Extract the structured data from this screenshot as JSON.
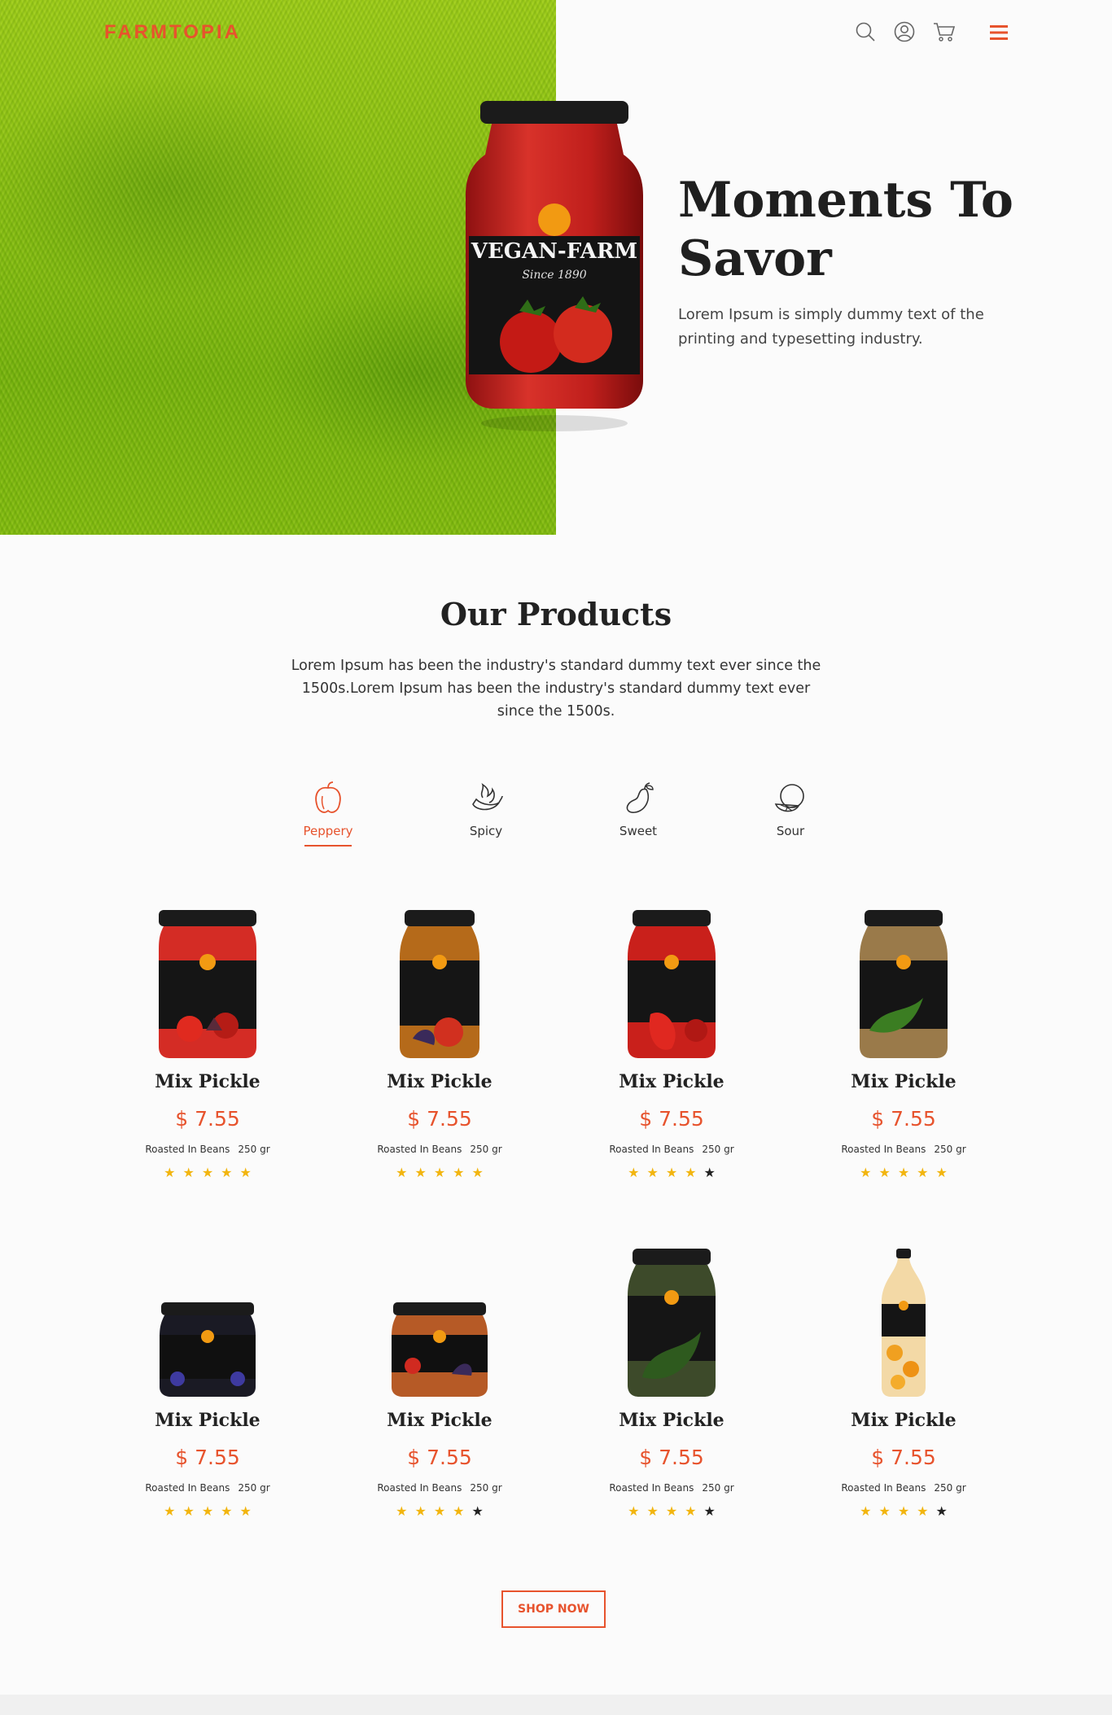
{
  "brand": {
    "logo": "FARMTOPIA",
    "accent": "#e7532d"
  },
  "header": {
    "icons": [
      "search-icon",
      "user-icon",
      "cart-icon",
      "menu-icon"
    ]
  },
  "hero": {
    "title": "Moments To Savor",
    "text": "Lorem Ipsum is simply dummy text of the printing and typesetting industry.",
    "jar_label": "VEGAN-FARM",
    "jar_sub": "Since 1890"
  },
  "products_section": {
    "title": "Our Products",
    "text": "Lorem Ipsum has been the industry's standard dummy text ever since the 1500s.Lorem Ipsum has been the industry's standard dummy text ever since the 1500s."
  },
  "categories": [
    {
      "label": "Peppery",
      "icon": "bell-pepper-icon",
      "active": true
    },
    {
      "label": "Spicy",
      "icon": "chili-flame-icon",
      "active": false
    },
    {
      "label": "Sweet",
      "icon": "mango-icon",
      "active": false
    },
    {
      "label": "Sour",
      "icon": "citrus-icon",
      "active": false
    }
  ],
  "products": [
    {
      "name": "Mix Pickle",
      "price": "$ 7.55",
      "tag": "Roasted In Beans",
      "weight": "250 gr",
      "rating": 5
    },
    {
      "name": "Mix Pickle",
      "price": "$ 7.55",
      "tag": "Roasted In Beans",
      "weight": "250 gr",
      "rating": 5
    },
    {
      "name": "Mix Pickle",
      "price": "$ 7.55",
      "tag": "Roasted In Beans",
      "weight": "250 gr",
      "rating": 4
    },
    {
      "name": "Mix Pickle",
      "price": "$ 7.55",
      "tag": "Roasted In Beans",
      "weight": "250 gr",
      "rating": 5
    },
    {
      "name": "Mix Pickle",
      "price": "$ 7.55",
      "tag": "Roasted In Beans",
      "weight": "250 gr",
      "rating": 5
    },
    {
      "name": "Mix Pickle",
      "price": "$ 7.55",
      "tag": "Roasted In Beans",
      "weight": "250 gr",
      "rating": 4
    },
    {
      "name": "Mix Pickle",
      "price": "$ 7.55",
      "tag": "Roasted In Beans",
      "weight": "250 gr",
      "rating": 4
    },
    {
      "name": "Mix Pickle",
      "price": "$ 7.55",
      "tag": "Roasted In Beans",
      "weight": "250 gr",
      "rating": 4
    }
  ],
  "cta": {
    "label": "SHOP NOW"
  }
}
